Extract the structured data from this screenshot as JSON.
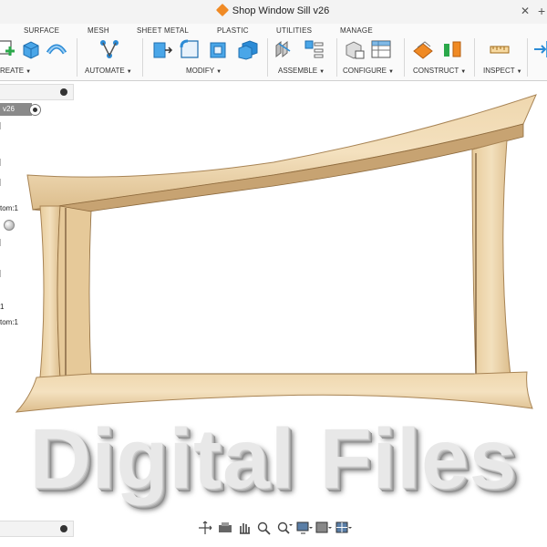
{
  "window": {
    "title": "Shop Window Sill v26"
  },
  "ribbon": {
    "tabs": [
      "SURFACE",
      "MESH",
      "SHEET METAL",
      "PLASTIC",
      "UTILITIES",
      "MANAGE"
    ],
    "groups": [
      "REATE",
      "AUTOMATE",
      "MODIFY",
      "ASSEMBLE",
      "CONFIGURE",
      "CONSTRUCT",
      "INSPECT"
    ]
  },
  "browser": {
    "root": "v26",
    "items": [
      "tom:1",
      "1",
      "tom:1"
    ]
  },
  "headline": "Digital Files",
  "colors": {
    "accent_orange": "#f08a24",
    "wood_light": "#ecd3a9",
    "wood_dark": "#d3b080",
    "ribbon_blue": "#2b8bd6"
  }
}
